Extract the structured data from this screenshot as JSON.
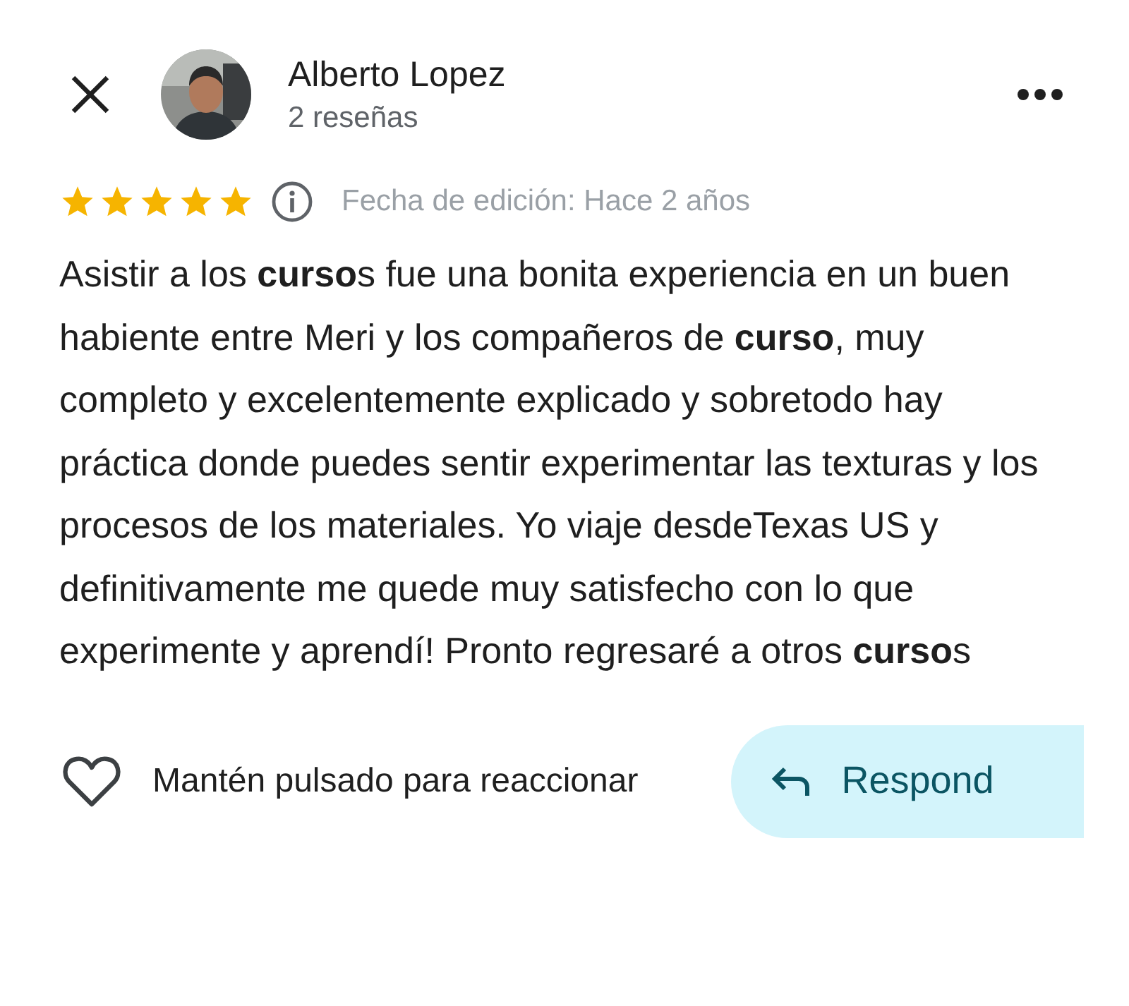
{
  "reviewer": {
    "name": "Alberto Lopez",
    "reviews": "2 reseñas"
  },
  "review": {
    "stars": 5,
    "edited": "Fecha de edición: Hace 2 años",
    "text": "Asistir a los **curso**s fue una bonita experiencia en un buen habiente entre Meri y los compañeros de **curso**, muy completo y excelentemente explicado y sobretodo hay práctica donde puedes sentir experimentar las texturas y los procesos de los materiales. Yo viaje desdeTexas US y definitivamente me quede muy satisfecho con lo que experimente y aprendí! Pronto regresaré a otros **curso**s"
  },
  "actions": {
    "react": "Mantén pulsado para reaccionar",
    "reply": "Respond"
  }
}
